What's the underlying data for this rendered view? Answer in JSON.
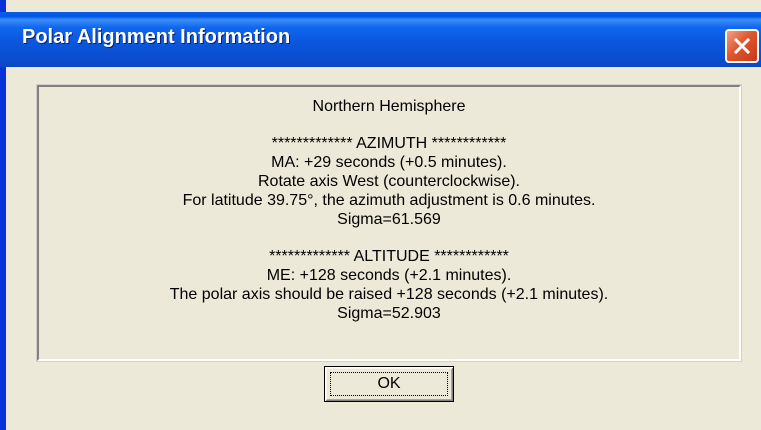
{
  "window": {
    "title": "Polar Alignment Information",
    "close_icon": "close-icon",
    "colors": {
      "titlebar": "#0a57dd",
      "close_button": "#e0562e",
      "client": "#ece9d8"
    }
  },
  "content": {
    "hemisphere": "Northern Hemisphere",
    "azimuth": {
      "heading": "************* AZIMUTH ************",
      "ma": "MA: +29 seconds (+0.5 minutes).",
      "rotate": "Rotate axis West (counterclockwise).",
      "latitude": "For latitude 39.75°, the azimuth adjustment is 0.6 minutes.",
      "sigma": "Sigma=61.569"
    },
    "altitude": {
      "heading": "************* ALTITUDE ************",
      "me": "ME: +128 seconds (+2.1 minutes).",
      "raise": "The polar axis should be raised +128 seconds (+2.1 minutes).",
      "sigma": "Sigma=52.903"
    }
  },
  "buttons": {
    "ok_label": "OK"
  }
}
